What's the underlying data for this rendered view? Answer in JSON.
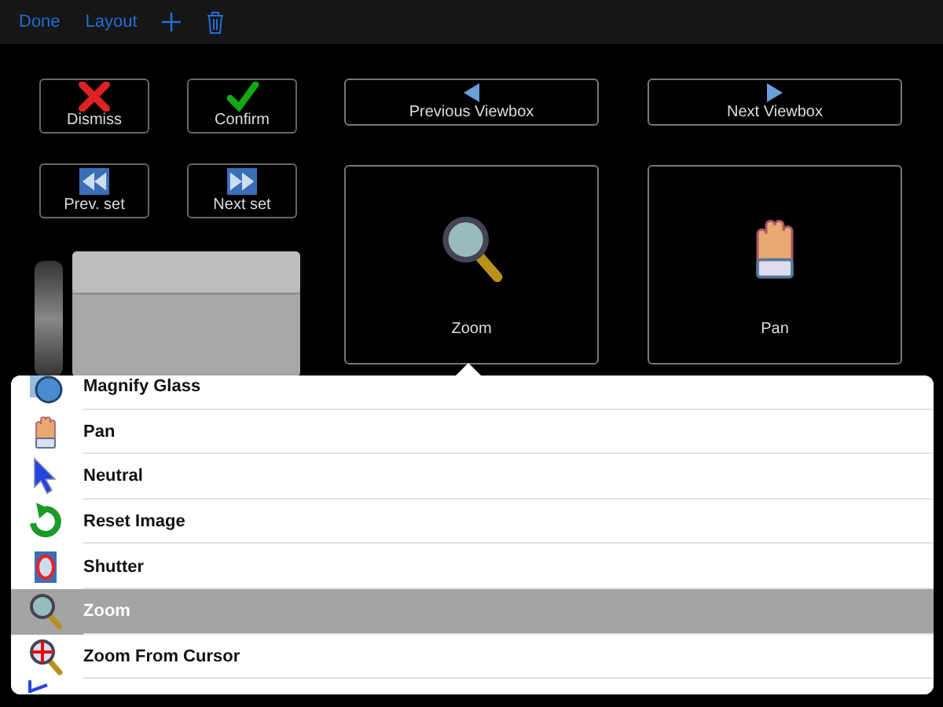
{
  "toolbar": {
    "done": "Done",
    "layout": "Layout"
  },
  "action_buttons": [
    {
      "label": "Dismiss",
      "kind": "dismiss"
    },
    {
      "label": "Confirm",
      "kind": "confirm"
    },
    {
      "label": "Prev. set",
      "kind": "prev-set"
    },
    {
      "label": "Next set",
      "kind": "next-set"
    }
  ],
  "viewbox_buttons": [
    {
      "label": "Previous Viewbox",
      "kind": "previous"
    },
    {
      "label": "Next Viewbox",
      "kind": "next"
    }
  ],
  "tool_tiles": [
    {
      "label": "Zoom",
      "kind": "zoom"
    },
    {
      "label": "Pan",
      "kind": "pan"
    }
  ],
  "menu": {
    "items": [
      {
        "label": "Magnify Glass",
        "kind": "magnify",
        "selected": false
      },
      {
        "label": "Pan",
        "kind": "pan",
        "selected": false
      },
      {
        "label": "Neutral",
        "kind": "pointer",
        "selected": false
      },
      {
        "label": "Reset Image",
        "kind": "reset",
        "selected": false
      },
      {
        "label": "Shutter",
        "kind": "shutter",
        "selected": false
      },
      {
        "label": "Zoom",
        "kind": "zoom",
        "selected": true
      },
      {
        "label": "Zoom From Cursor",
        "kind": "zoom-cursor",
        "selected": false
      },
      {
        "kind": "angle",
        "selected": false
      }
    ]
  }
}
